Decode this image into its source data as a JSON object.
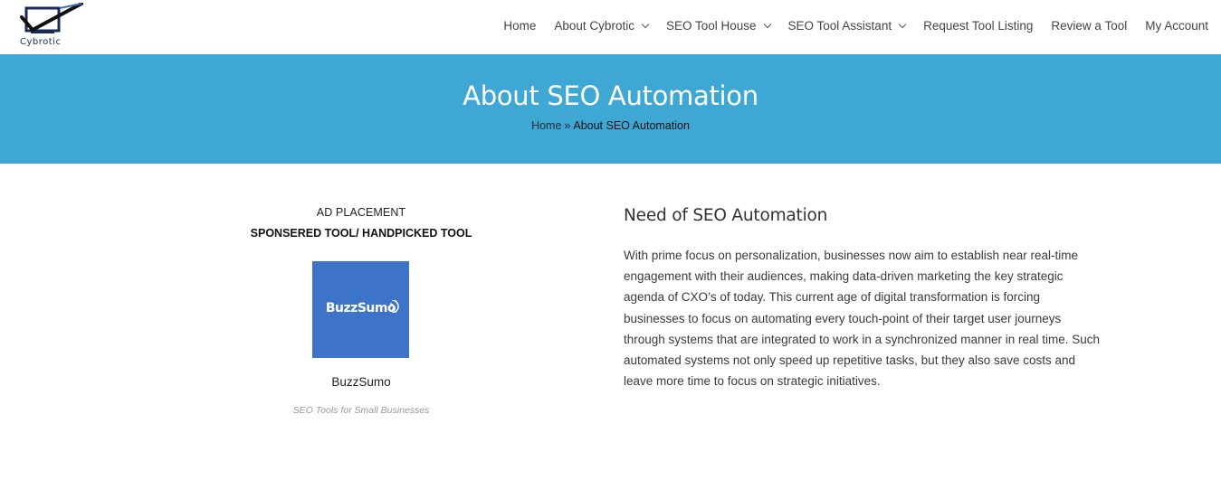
{
  "site": {
    "logo_text": "Cybrotic"
  },
  "nav": {
    "items": [
      {
        "label": "Home",
        "dropdown": false
      },
      {
        "label": "About Cybrotic",
        "dropdown": true
      },
      {
        "label": "SEO Tool House",
        "dropdown": true
      },
      {
        "label": "SEO Tool Assistant",
        "dropdown": true
      },
      {
        "label": "Request Tool Listing",
        "dropdown": false
      },
      {
        "label": "Review a Tool",
        "dropdown": false
      },
      {
        "label": "My Account",
        "dropdown": false
      }
    ]
  },
  "banner": {
    "title": "About SEO Automation",
    "breadcrumb_home": "Home",
    "breadcrumb_separator": "»",
    "breadcrumb_current": "About SEO Automation",
    "background_color": "#3ea7d4"
  },
  "ad": {
    "label": "AD PLACEMENT",
    "subtitle": "SPONSERED TOOL/ HANDPICKED TOOL",
    "image_text": "BuzzSumo",
    "image_color": "#3d73c8",
    "tool_name": "BuzzSumo",
    "tagline": "SEO Tools for Small Businesses"
  },
  "article": {
    "title": "Need of SEO Automation",
    "body": "With prime focus on personalization, businesses now aim to establish near real-time engagement with their audiences, making data-driven marketing the key strategic agenda of CXO’s of today. This current age of digital transformation is forcing businesses to focus on automating every touch-point of their target user journeys through systems that are integrated to work in a synchronized manner in real time. Such automated systems not only speed up repetitive tasks, but they also save costs and leave more time to focus on strategic initiatives."
  }
}
